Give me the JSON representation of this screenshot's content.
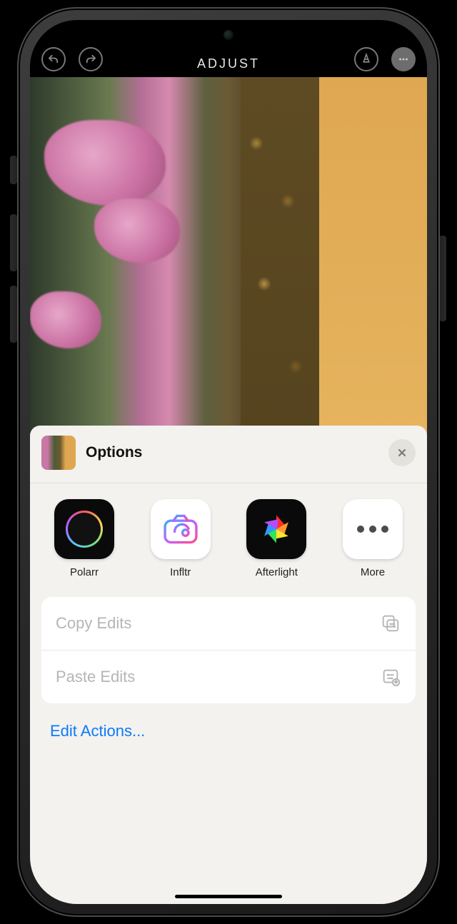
{
  "toolbar": {
    "title": "ADJUST"
  },
  "sheet": {
    "title": "Options",
    "apps": [
      {
        "name": "Polarr"
      },
      {
        "name": "Infltr"
      },
      {
        "name": "Afterlight"
      },
      {
        "name": "More"
      }
    ],
    "actions": {
      "copy": "Copy Edits",
      "paste": "Paste Edits",
      "edit_actions": "Edit Actions..."
    }
  }
}
